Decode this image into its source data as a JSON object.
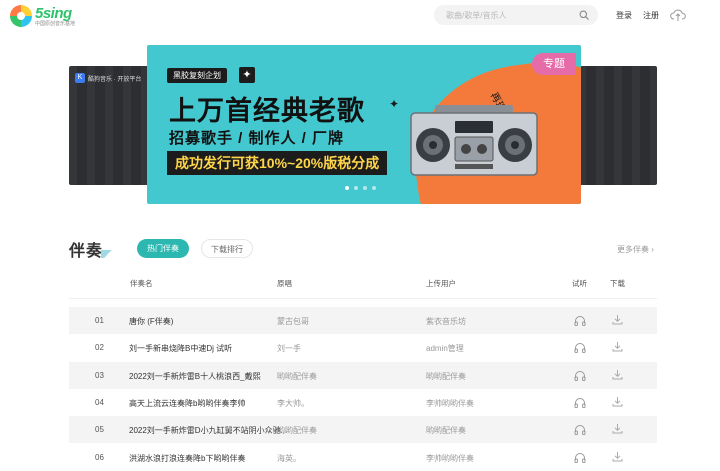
{
  "header": {
    "logo_word": "5sing",
    "logo_sub": "中国原创音乐基地",
    "search_placeholder": "歌曲/歌单/音乐人",
    "login": "登录",
    "register": "注册"
  },
  "banner": {
    "tag": "专题",
    "pill": "黑胶复刻企划",
    "title": "上万首经典老歌",
    "subtitle": "招募歌手 / 制作人 / 厂牌",
    "bar": "成功发行可获10%~20%版税分成",
    "curve_text": "再现经典旋律",
    "left_slide_tag": "酷狗音乐 · 开放平台",
    "slide_count": 4,
    "active_slide": 1
  },
  "section": {
    "title": "伴奏",
    "tabs": [
      {
        "label": "热门伴奏",
        "active": true
      },
      {
        "label": "下载排行",
        "active": false
      }
    ],
    "more": "更多伴奏 ›"
  },
  "table": {
    "headers": {
      "name": "伴奏名",
      "original": "原唱",
      "uploader": "上传用户",
      "listen": "试听",
      "download": "下载"
    },
    "rows": [
      {
        "no": "01",
        "name": "唐你 (F伴奏)",
        "original": "蒙古包哥",
        "uploader": "紫衣音乐坊"
      },
      {
        "no": "02",
        "name": "刘一手新串烧降B中速Dj 试听",
        "original": "刘一手",
        "uploader": "admin管理"
      },
      {
        "no": "03",
        "name": "2022刘一手新炸雷B十人桃浪西_戴熙",
        "original": "哟哟配伴奏",
        "uploader": "哟哟配伴奏"
      },
      {
        "no": "04",
        "name": "高天上流云连奏降b哟哟伴奏李帅",
        "original": "李大帅。",
        "uploader": "李帅哟哟伴奏"
      },
      {
        "no": "05",
        "name": "2022刘一手新炸雷D小九缸舅不站阴小众驰...",
        "original": "哟哟配伴奏",
        "uploader": "哟哟配伴奏"
      },
      {
        "no": "06",
        "name": "洪湖水浪打浪连奏降b下哟哟伴奏",
        "original": "海英。",
        "uploader": "李帅哟哟伴奏"
      }
    ]
  },
  "colors": {
    "accent": "#2cb7b0",
    "banner_bg": "#44c8cf",
    "banner_orange": "#f47a3c",
    "tag_pink": "#e56ca8"
  },
  "icons": {
    "search": "search-icon",
    "cloud": "cloud-upload-icon",
    "listen": "headphones-icon",
    "download": "download-icon"
  }
}
